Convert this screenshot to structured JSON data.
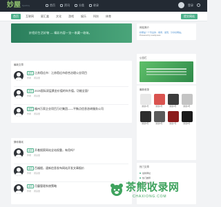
{
  "header": {
    "logo": "妙屋",
    "logo_sub": "liguoboy",
    "nav": [
      {
        "label": "首页",
        "icon": "home-icon"
      },
      {
        "label": "资讯",
        "icon": "news-icon"
      },
      {
        "label": "分类",
        "icon": "category-icon"
      },
      {
        "label": "收录",
        "icon": "collect-icon"
      }
    ],
    "user_label": "登录"
  },
  "categories": [
    "首页",
    "互联网",
    "星汇盒",
    "文化",
    "游戏",
    "娱乐",
    "科技",
    "体育"
  ],
  "submit_label": "提交网站",
  "banner_text": "妙招好生活好物 — 精彩内容一览一收藏一收纳。",
  "latest": {
    "title": "最新文章",
    "posts": [
      {
        "tag": "推荐",
        "title": "江苏宿迁市：江苏宿迁市综合治理公业项目",
        "meta": [
          "作者",
          "阅读量"
        ]
      },
      {
        "tag": "推荐",
        "title": "2025国际双层黄金价值的年升值，功能全面！",
        "meta": [
          "作者",
          "阅读量"
        ]
      },
      {
        "tag": "推荐",
        "title": "福州万家企业项目万亿集团——平衡点信息咨询服务公司",
        "meta": [
          "作者",
          "阅读量"
        ]
      }
    ]
  },
  "recommend": {
    "title": "猜你喜欢",
    "posts": [
      {
        "tag": "推荐",
        "title": "开着搜索网站全站权重，有用吗？",
        "meta": [
          "作者",
          "阅读量"
        ]
      },
      {
        "tag": "推荐",
        "title": "百福楼，速新信息发布网站开发文章报价",
        "meta": [
          "作者",
          "阅读量"
        ]
      },
      {
        "tag": "推荐",
        "title": "月震管理系统策略",
        "meta": [
          "作者",
          "阅读量"
        ]
      }
    ]
  },
  "sidebar": {
    "site_info": {
      "title": "网站简介",
      "desc": "妙屋是一个专业的…收录、发现、分享好网站。",
      "desc2": "Powered by wordpress"
    },
    "ad": {
      "title": "公告栏"
    },
    "apps": {
      "title": "最新收录",
      "items": [
        {
          "label": "妙屋1号",
          "color": "#e8e8e8"
        },
        {
          "label": "妙屋2号",
          "color": "#d9534f"
        },
        {
          "label": "妙屋3号",
          "color": "#3c3c3c"
        },
        {
          "label": "妙屋4号",
          "color": "#c4c4c4"
        },
        {
          "label": "妙屋5号",
          "color": "#2e2e2e"
        },
        {
          "label": "妙屋6号",
          "color": "#5a5a5a"
        },
        {
          "label": "妙屋7号",
          "color": "#8b1c1c"
        },
        {
          "label": "妙屋8号",
          "color": "#1a1a1a"
        }
      ]
    },
    "hot": {
      "title": "热门文章",
      "items": [
        "最新网址",
        "热门推荐",
        "精选站点"
      ]
    }
  },
  "watermark": {
    "text": "茶熊收录网",
    "url": "CHAXIONG.COM"
  },
  "colors": {
    "accent": "#4caf8a",
    "header_bg": "#232a33"
  }
}
